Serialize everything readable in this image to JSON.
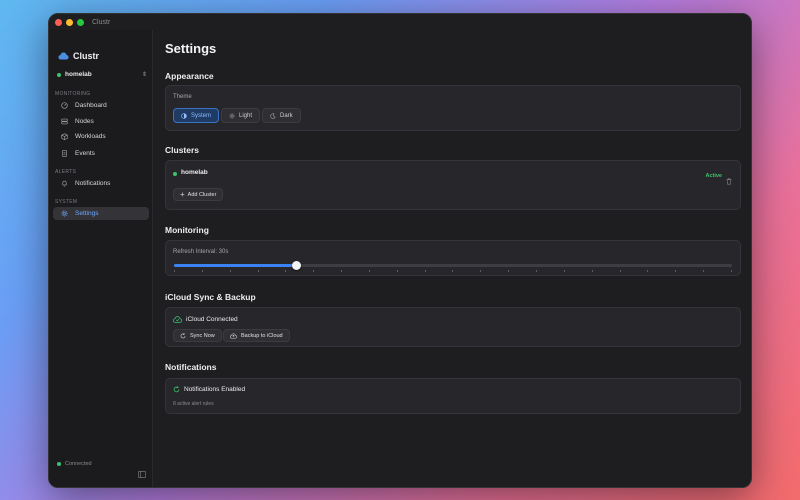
{
  "window": {
    "title": "Clustr"
  },
  "sidebar": {
    "brand": "Clustr",
    "cluster_selector": {
      "value": "homelab",
      "status_color": "#3cc36b"
    },
    "sections": [
      {
        "label": "MONITORING",
        "items": [
          {
            "label": "Dashboard",
            "icon": "dashboard-icon"
          },
          {
            "label": "Nodes",
            "icon": "server-icon"
          },
          {
            "label": "Workloads",
            "icon": "cube-icon"
          },
          {
            "label": "Events",
            "icon": "document-icon"
          }
        ]
      },
      {
        "label": "ALERTS",
        "items": [
          {
            "label": "Notifications",
            "icon": "bell-icon"
          }
        ]
      },
      {
        "label": "SYSTEM",
        "items": [
          {
            "label": "Settings",
            "icon": "gear-icon",
            "active": true
          }
        ]
      }
    ],
    "connection_status": "Connected"
  },
  "main": {
    "title": "Settings",
    "appearance": {
      "title": "Appearance",
      "theme_label": "Theme",
      "options": [
        {
          "label": "System",
          "icon": "half-circle-icon",
          "selected": true
        },
        {
          "label": "Light",
          "icon": "sun-icon",
          "selected": false
        },
        {
          "label": "Dark",
          "icon": "moon-icon",
          "selected": false
        }
      ]
    },
    "clusters": {
      "title": "Clusters",
      "items": [
        {
          "name": "homelab",
          "status": "Active"
        }
      ],
      "add_label": "Add Cluster"
    },
    "monitoring": {
      "title": "Monitoring",
      "refresh_label": "Refresh Interval: 30s",
      "slider_fraction": 0.22,
      "tick_count": 21
    },
    "icloud": {
      "title": "iCloud Sync & Backup",
      "status": "iCloud Connected",
      "sync_label": "Sync Now",
      "backup_label": "Backup to iCloud"
    },
    "notifications": {
      "title": "Notifications",
      "status": "Notifications Enabled",
      "sub": "8 active alert rules"
    }
  },
  "colors": {
    "accent": "#3b82f6",
    "success": "#3cc36b",
    "background": "#1e1e21"
  }
}
